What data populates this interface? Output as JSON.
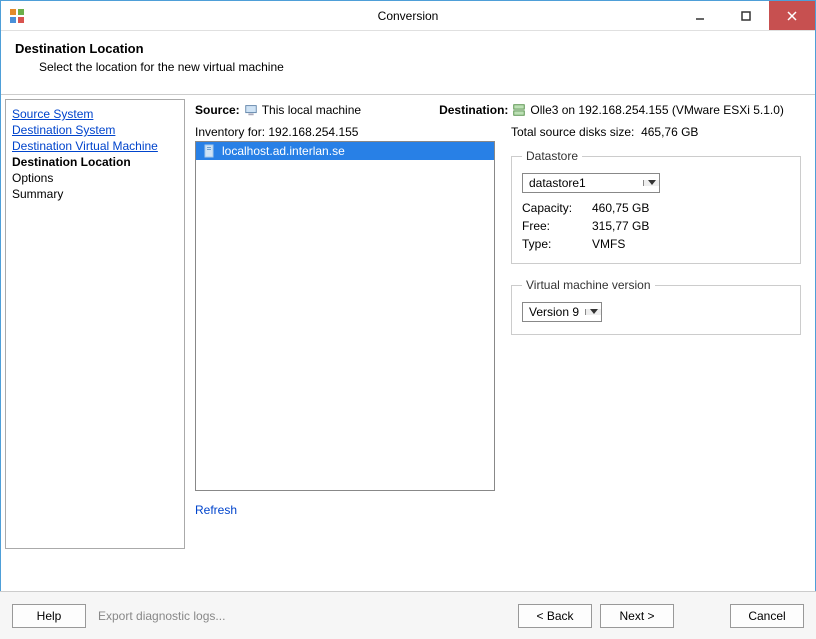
{
  "window": {
    "title": "Conversion"
  },
  "header": {
    "title": "Destination Location",
    "subtitle": "Select the location for the new virtual machine"
  },
  "sidebar": {
    "items": [
      {
        "label": "Source System",
        "state": "link"
      },
      {
        "label": "Destination System",
        "state": "link"
      },
      {
        "label": "Destination Virtual Machine",
        "state": "link"
      },
      {
        "label": "Destination Location",
        "state": "current"
      },
      {
        "label": "Options",
        "state": "plain"
      },
      {
        "label": "Summary",
        "state": "plain"
      }
    ]
  },
  "main": {
    "source_label": "Source:",
    "source_value": "This local machine",
    "dest_label": "Destination:",
    "dest_value": "Olle3 on 192.168.254.155 (VMware ESXi 5.1.0)",
    "inventory_for_label": "Inventory for:",
    "inventory_for_value": "192.168.254.155",
    "tree_item": "localhost.ad.interlan.se",
    "refresh": "Refresh",
    "total_disks_label": "Total source disks size:",
    "total_disks_value": "465,76 GB",
    "datastore": {
      "legend": "Datastore",
      "selected": "datastore1",
      "capacity_label": "Capacity:",
      "capacity_value": "460,75 GB",
      "free_label": "Free:",
      "free_value": "315,77 GB",
      "type_label": "Type:",
      "type_value": "VMFS"
    },
    "vmversion": {
      "legend": "Virtual machine version",
      "selected": "Version 9"
    }
  },
  "footer": {
    "help": "Help",
    "export": "Export diagnostic logs...",
    "back": "< Back",
    "next": "Next >",
    "cancel": "Cancel"
  }
}
